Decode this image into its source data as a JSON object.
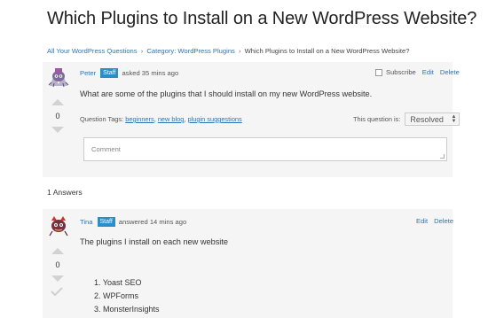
{
  "page": {
    "title": "Which Plugins to Install on a New WordPress Website?"
  },
  "breadcrumb": {
    "items": [
      {
        "label": "All Your WordPress Questions"
      },
      {
        "label": "Category: WordPress Plugins"
      },
      {
        "label": "Which Plugins to Install on a New WordPress Website?"
      }
    ],
    "separator": "›"
  },
  "question": {
    "author": "Peter",
    "badge": "Staff",
    "time": "asked 35 mins ago",
    "subscribe_label": "Subscribe",
    "edit_label": "Edit",
    "delete_label": "Delete",
    "votes": "0",
    "body": "What are some of the plugins that I should install on my new WordPress website.",
    "tags_label": "Question Tags:",
    "tags": [
      "beginners",
      "new blog",
      "plugin suggestions"
    ],
    "status_label": "This question is:",
    "status_value": "Resolved",
    "comment_placeholder": "Comment"
  },
  "answers": {
    "count_label": "1 Answers"
  },
  "answer": {
    "author": "Tina",
    "badge": "Staff",
    "time": "answered 14 mins ago",
    "edit_label": "Edit",
    "delete_label": "Delete",
    "votes": "0",
    "body": "The plugins I install on each new website",
    "list": [
      "1. Yoast SEO",
      "2. WPForms",
      "3. MonsterInsights"
    ]
  },
  "colors": {
    "link": "#2a75b8",
    "badge": "#2a8ec9",
    "panel": "#f5f5f5"
  }
}
